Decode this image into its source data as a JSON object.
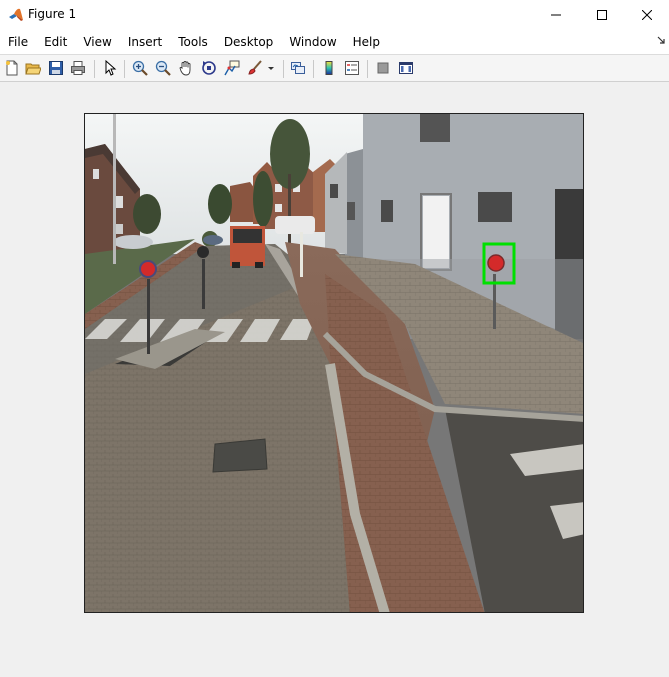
{
  "window": {
    "title": "Figure 1",
    "controls": {
      "minimize": "—",
      "maximize": "☐",
      "close": "✕"
    }
  },
  "menu": [
    "File",
    "Edit",
    "View",
    "Insert",
    "Tools",
    "Desktop",
    "Window",
    "Help"
  ],
  "toolbar": [
    "new-figure-icon",
    "open-file-icon",
    "save-icon",
    "print-icon",
    "select-arrow-icon",
    "zoom-in-icon",
    "zoom-out-icon",
    "pan-hand-icon",
    "rotate-3d-icon",
    "data-cursor-icon",
    "brush-icon",
    "brush-dropdown-icon",
    "link-plot-icon",
    "colorbar-icon",
    "legend-icon",
    "hide-plot-tools-icon",
    "show-plot-tools-icon"
  ],
  "figure": {
    "detection_box_color": "#00e000",
    "sign_color": "#d42a2a"
  }
}
